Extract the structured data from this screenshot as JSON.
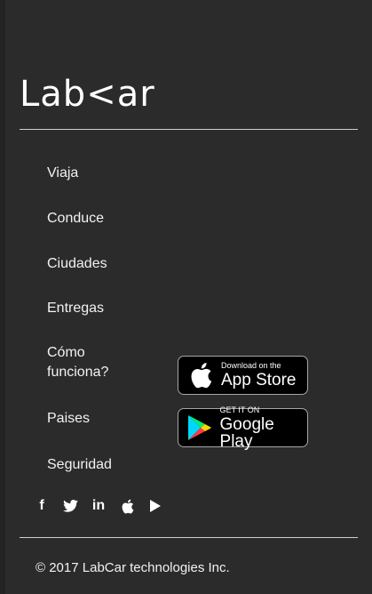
{
  "brand": {
    "logo_text": "Lab<ar"
  },
  "nav": {
    "items": [
      {
        "label": "Viaja"
      },
      {
        "label": "Conduce"
      },
      {
        "label": "Ciudades"
      },
      {
        "label": "Entregas"
      },
      {
        "label": "Cómo funciona?"
      },
      {
        "label": "Paises"
      },
      {
        "label": "Seguridad"
      }
    ]
  },
  "stores": {
    "apple": {
      "small": "Download on the",
      "big": "App Store",
      "icon": "apple-icon"
    },
    "google": {
      "small": "GET IT ON",
      "big": "Google Play",
      "icon": "google-play-icon"
    }
  },
  "social": {
    "icons": [
      "facebook-icon",
      "twitter-icon",
      "linkedin-icon",
      "apple-icon",
      "play-icon"
    ],
    "facebook": "f",
    "linkedin": "in"
  },
  "footer": {
    "copyright": "© 2017 LabCar technologies Inc."
  },
  "colors": {
    "background": "#2b2b2b",
    "text": "#ffffff",
    "divider": "#cfcfcf",
    "store_button": "#000000"
  }
}
